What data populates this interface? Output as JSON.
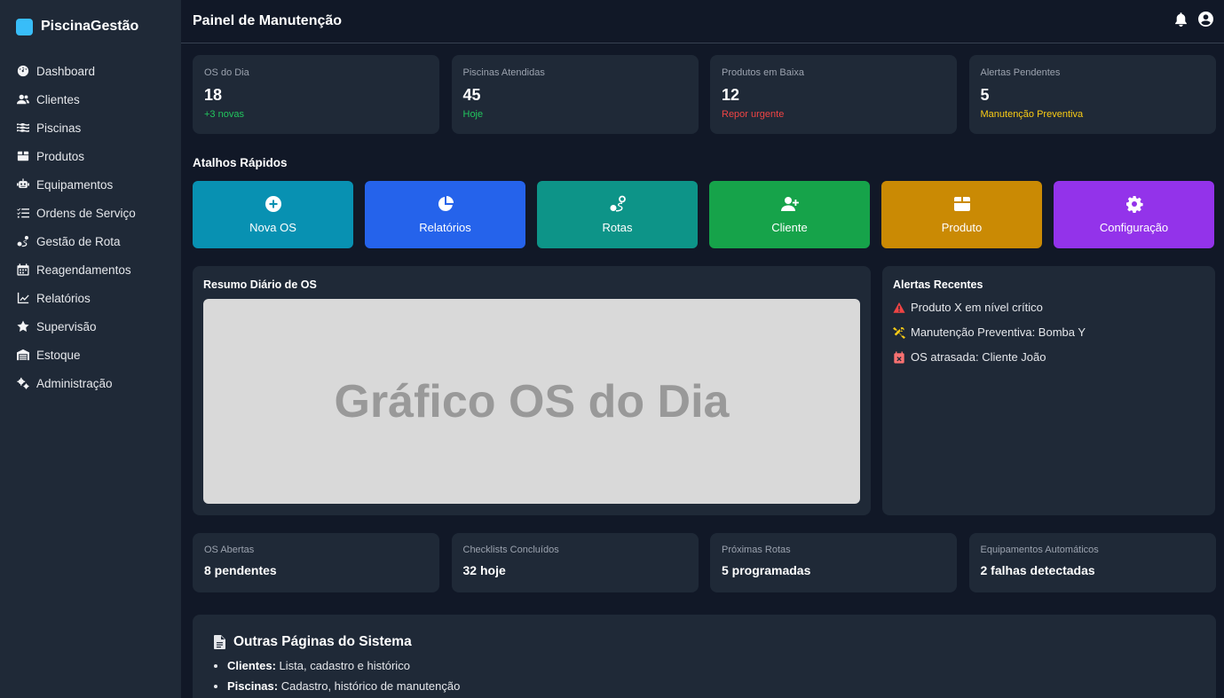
{
  "brand": {
    "name": "PiscinaGestão",
    "logo_color": "#38bdf8"
  },
  "sidebar": {
    "items": [
      {
        "label": "Dashboard",
        "icon": "gauge-icon"
      },
      {
        "label": "Clientes",
        "icon": "users-icon"
      },
      {
        "label": "Piscinas",
        "icon": "water-icon"
      },
      {
        "label": "Produtos",
        "icon": "box-icon"
      },
      {
        "label": "Equipamentos",
        "icon": "robot-icon"
      },
      {
        "label": "Ordens de Serviço",
        "icon": "list-check-icon"
      },
      {
        "label": "Gestão de Rota",
        "icon": "route-icon"
      },
      {
        "label": "Reagendamentos",
        "icon": "calendar-icon"
      },
      {
        "label": "Relatórios",
        "icon": "chart-line-icon"
      },
      {
        "label": "Supervisão",
        "icon": "star-icon"
      },
      {
        "label": "Estoque",
        "icon": "warehouse-icon"
      },
      {
        "label": "Administração",
        "icon": "gears-icon"
      }
    ]
  },
  "header": {
    "title": "Painel de Manutenção",
    "icons": [
      "bell-icon",
      "user-circle-icon"
    ]
  },
  "stats": [
    {
      "label": "OS do Dia",
      "value": "18",
      "sub": "+3 novas",
      "sub_color": "#22c55e"
    },
    {
      "label": "Piscinas Atendidas",
      "value": "45",
      "sub": "Hoje",
      "sub_color": "#22c55e"
    },
    {
      "label": "Produtos em Baixa",
      "value": "12",
      "sub": "Repor urgente",
      "sub_color": "#ef4444"
    },
    {
      "label": "Alertas Pendentes",
      "value": "5",
      "sub": "Manutenção Preventiva",
      "sub_color": "#facc15"
    }
  ],
  "shortcuts": {
    "title": "Atalhos Rápidos",
    "items": [
      {
        "label": "Nova OS",
        "icon": "plus-circle-icon",
        "color": "#0891b2"
      },
      {
        "label": "Relatórios",
        "icon": "pie-chart-icon",
        "color": "#2563eb"
      },
      {
        "label": "Rotas",
        "icon": "route-icon",
        "color": "#0d9488"
      },
      {
        "label": "Cliente",
        "icon": "user-plus-icon",
        "color": "#16a34a"
      },
      {
        "label": "Produto",
        "icon": "box-icon",
        "color": "#ca8a04"
      },
      {
        "label": "Configuração",
        "icon": "gear-icon",
        "color": "#9333ea"
      }
    ]
  },
  "chart_card": {
    "title": "Resumo Diário de OS",
    "placeholder": "Gráfico OS do Dia"
  },
  "alerts": {
    "title": "Alertas Recentes",
    "items": [
      {
        "text": "Produto X em nível crítico",
        "icon": "warning-icon",
        "color": "#ef4444"
      },
      {
        "text": "Manutenção Preventiva: Bomba Y",
        "icon": "tools-icon",
        "color": "#facc15"
      },
      {
        "text": "OS atrasada: Cliente João",
        "icon": "calendar-x-icon",
        "color": "#f87171"
      }
    ]
  },
  "mini_stats": [
    {
      "label": "OS Abertas",
      "value": "8 pendentes"
    },
    {
      "label": "Checklists Concluídos",
      "value": "32 hoje"
    },
    {
      "label": "Próximas Rotas",
      "value": "5 programadas"
    },
    {
      "label": "Equipamentos Automáticos",
      "value": "2 falhas detectadas"
    }
  ],
  "other_pages": {
    "title": "Outras Páginas do Sistema",
    "items": [
      {
        "name": "Clientes:",
        "desc": " Lista, cadastro e histórico"
      },
      {
        "name": "Piscinas:",
        "desc": " Cadastro, histórico de manutenção"
      }
    ]
  }
}
